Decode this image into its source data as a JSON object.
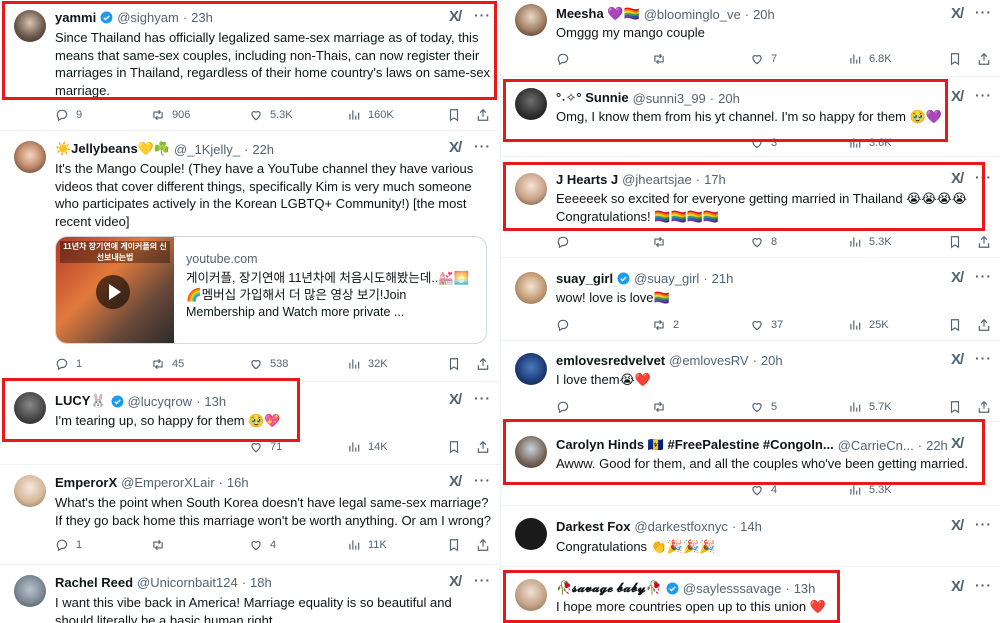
{
  "icons": {
    "grok": "grok-icon",
    "more": "more-icon",
    "reply": "reply-icon",
    "retweet": "retweet-icon",
    "like": "like-icon",
    "views": "views-icon",
    "bookmark": "bookmark-icon",
    "share": "share-icon",
    "play": "play-icon"
  },
  "colors": {
    "highlight": "#e8181b",
    "verified": "#1d9bf0",
    "muted": "#536471"
  },
  "left": [
    {
      "name": "yammi",
      "handle": "@sighyam",
      "time": "23h",
      "verified": true,
      "text": "Since Thailand has officially legalized same-sex marriage as of today, this means that same-sex couples, including non-Thais, can now register their marriages in Thailand, regardless of their home country's laws on same-sex marriage.",
      "replies": "9",
      "retweets": "906",
      "likes": "5.3K",
      "views": "160K"
    },
    {
      "name": "☀️Jellybeans💛☘️",
      "handle": "@_1Kjelly_",
      "time": "22h",
      "verified": false,
      "text": "It's the Mango Couple! (They have a YouTube channel they have various videos that cover different things, specifically Kim is very much someone who participates actively in the Korean LGBTQ+ Community!) [the most recent video]",
      "card": {
        "thumb_text": "11년차 장기연애 게이커플의 신선보내는법",
        "domain": "youtube.com",
        "title": "게이커플, 장기연애 11년차에 처음시도해봤는데..💒🌅 🌈멤버십 가입해서 더 많은 영상 보기!Join Membership and Watch more private ..."
      },
      "replies": "1",
      "retweets": "45",
      "likes": "538",
      "views": "32K"
    },
    {
      "name": "LUCY🐰",
      "handle": "@lucyqrow",
      "time": "13h",
      "verified": true,
      "text": "I'm tearing up, so happy for them 🥹💖",
      "replies": "",
      "retweets": "",
      "likes": "71",
      "views": "14K"
    },
    {
      "name": "EmperorX",
      "handle": "@EmperorXLair",
      "time": "16h",
      "verified": false,
      "text": "What's the point when South Korea doesn't have legal same-sex marriage? If they go back home this marriage won't be worth anything. Or am I wrong?",
      "replies": "1",
      "retweets": "",
      "likes": "4",
      "views": "11K"
    },
    {
      "name": "Rachel Reed",
      "handle": "@Unicornbait124",
      "time": "18h",
      "verified": false,
      "text": "I want this vibe back in America! Marriage equality is so beautiful and should literally be a basic human right",
      "replies": "",
      "retweets": "",
      "likes": "",
      "views": ""
    }
  ],
  "right": [
    {
      "name": "Meesha 💜🏳️‍🌈",
      "handle": "@bloominglo_ve",
      "time": "20h",
      "verified": false,
      "text": "Omggg my mango couple",
      "replies": "",
      "retweets": "",
      "likes": "7",
      "views": "6.8K"
    },
    {
      "name": "°˖✧° Sunnie",
      "handle": "@sunni3_99",
      "time": "20h",
      "verified": false,
      "text": "Omg, I know them from his yt channel. I'm so happy for them 🥹💜",
      "replies": "",
      "retweets": "",
      "likes": "3",
      "views": "3.6K"
    },
    {
      "name": "J Hearts J",
      "handle": "@jheartsjae",
      "time": "17h",
      "verified": false,
      "text": "Eeeeeek so excited for everyone getting married in Thailand 😭😭😭😭 Congratulations! 🏳️‍🌈🏳️‍🌈🏳️‍🌈🏳️‍🌈",
      "replies": "",
      "retweets": "",
      "likes": "8",
      "views": "5.3K"
    },
    {
      "name": "suay_girl",
      "handle": "@suay_girl",
      "time": "21h",
      "verified": true,
      "text": "wow!  love is love🏳️‍🌈",
      "replies": "",
      "retweets": "2",
      "likes": "37",
      "views": "25K"
    },
    {
      "name": "emlovesredvelvet",
      "handle": "@emlovesRV",
      "time": "20h",
      "verified": false,
      "text": "I love them😭❤️",
      "replies": "",
      "retweets": "",
      "likes": "5",
      "views": "5.7K"
    },
    {
      "name": "Carolyn Hinds 🇧🇧 #FreePalestine #CongoIn...",
      "handle": "@CarrieCn...",
      "time": "22h",
      "verified": false,
      "text": "Awww. Good for them, and all the couples who've been getting married.",
      "replies": "",
      "retweets": "",
      "likes": "4",
      "views": "5.3K"
    },
    {
      "name": "Darkest Fox",
      "handle": "@darkestfoxnyc",
      "time": "14h",
      "verified": false,
      "text": "Congratulations 👏🎉🎉🎉",
      "replies": "",
      "retweets": "",
      "likes": "",
      "views": ""
    },
    {
      "name": "🥀𝓼𝓪𝓿𝓪𝓰𝓮 𝓫𝓪𝓫𝔂🥀",
      "handle": "@saylesssavage",
      "time": "13h",
      "verified": true,
      "text": "I hope more countries open up to this union ❤️",
      "replies": "",
      "retweets": "",
      "likes": "",
      "views": ""
    }
  ]
}
